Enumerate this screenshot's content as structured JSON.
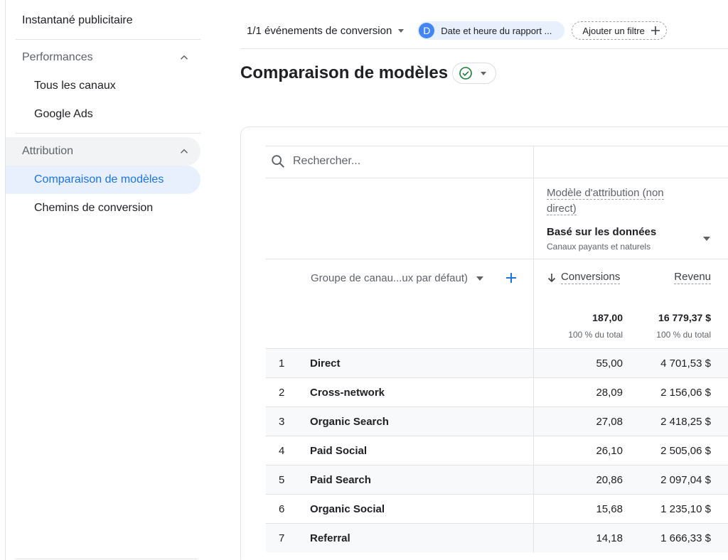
{
  "sidebar": {
    "top_item": "Instantané publicitaire",
    "sections": [
      {
        "label": "Performances",
        "items": [
          "Tous les canaux",
          "Google Ads"
        ]
      },
      {
        "label": "Attribution",
        "items": [
          "Comparaison de modèles",
          "Chemins de conversion"
        ]
      }
    ]
  },
  "topbar": {
    "conversion_select": "1/1 événements de conversion",
    "chip_avatar": "D",
    "chip_label": "Date et heure du rapport ...",
    "add_filter": "Ajouter un filtre"
  },
  "page": {
    "title": "Comparaison de modèles"
  },
  "table": {
    "search_placeholder": "Rechercher...",
    "model_label": "Modèle d'attribution (non direct)",
    "model_name": "Basé sur les données",
    "model_sub": "Canaux payants et naturels",
    "group_select": "Groupe de canau...ux par défaut)",
    "columns": {
      "conversions": "Conversions",
      "revenue": "Revenu"
    },
    "totals": {
      "conversions": "187,00",
      "conversions_sub": "100 % du total",
      "revenue": "16 779,37 $",
      "revenue_sub": "100 % du total"
    },
    "rows": [
      {
        "idx": "1",
        "name": "Direct",
        "conversions": "55,00",
        "revenue": "4 701,53 $"
      },
      {
        "idx": "2",
        "name": "Cross-network",
        "conversions": "28,09",
        "revenue": "2 156,06 $"
      },
      {
        "idx": "3",
        "name": "Organic Search",
        "conversions": "27,08",
        "revenue": "2 418,25 $"
      },
      {
        "idx": "4",
        "name": "Paid Social",
        "conversions": "26,10",
        "revenue": "2 505,06 $"
      },
      {
        "idx": "5",
        "name": "Paid Search",
        "conversions": "20,86",
        "revenue": "2 097,04 $"
      },
      {
        "idx": "6",
        "name": "Organic Social",
        "conversions": "15,68",
        "revenue": "1 235,10 $"
      },
      {
        "idx": "7",
        "name": "Referral",
        "conversions": "14,18",
        "revenue": "1 666,33 $"
      }
    ]
  },
  "colors": {
    "accent": "#1a73e8",
    "active_bg": "#e8f0fe",
    "check": "#188038"
  },
  "icons": [
    "chevron-up-icon",
    "caret-down-icon",
    "plus-icon",
    "check-circle-icon",
    "search-icon",
    "arrow-down-icon"
  ]
}
